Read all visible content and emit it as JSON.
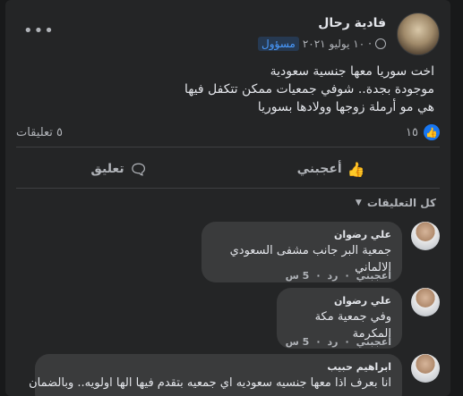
{
  "post": {
    "author": "فادية رحال",
    "role_badge": "مسؤول",
    "date": "١٠ يوليو ٢٠٢١",
    "text_lines": [
      "اخت سوريا معها جنسية سعودية",
      "موجودة بجدة.. شوفي جمعيات ممكن تتكفل فيها",
      "هي مو أرملة زوجها وولادها بسوريا"
    ]
  },
  "stats": {
    "likes": "١٥",
    "comments": "٥ تعليقات"
  },
  "actions": {
    "like": "أعجبني",
    "comment": "تعليق"
  },
  "comments_header": {
    "sort_label": "كل التعليقات"
  },
  "comments": [
    {
      "name": "علي رضوان",
      "text": "جمعية البر جانب مشفى السعودي الالماني",
      "like": "أعجبني",
      "reply": "رد",
      "age": "5 س"
    },
    {
      "name": "علي رضوان",
      "text": "وفي جمعية مكة المكرمة",
      "like": "أعجبني",
      "reply": "رد",
      "age": "5 س"
    },
    {
      "name": "ابراهيم حبيب",
      "text_lines": [
        "انا بعرف اذا معها جنسيه سعوديه اي جمعيه بتقدم فيها الها اولويه.. وبالضمان"
      ]
    }
  ],
  "colors": {
    "background": "#18191a",
    "card": "#242526",
    "bubble": "#3a3b3c",
    "accent": "#1877f2",
    "badge_text": "#4a9bff",
    "muted": "#b0b3b8"
  }
}
